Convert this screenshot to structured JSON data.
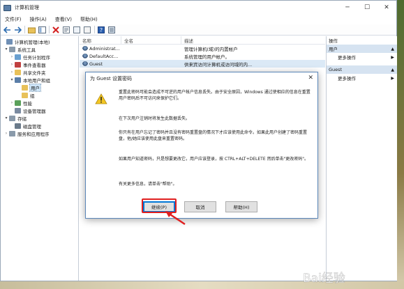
{
  "window": {
    "title": "计算机管理",
    "minimize": "─",
    "maximize": "☐",
    "close": "✕"
  },
  "menu": [
    "文件(F)",
    "操作(A)",
    "查看(V)",
    "帮助(H)"
  ],
  "tree": {
    "root": "计算机管理(本地)",
    "system_tools": "系统工具",
    "task_scheduler": "任务计划程序",
    "event_viewer": "事件查看器",
    "shared_folders": "共享文件夹",
    "local_users_groups": "本地用户和组",
    "users": "用户",
    "groups": "组",
    "performance": "性能",
    "device_manager": "设备管理器",
    "storage": "存储",
    "disk_management": "磁盘管理",
    "services_apps": "服务和应用程序"
  },
  "list": {
    "headers": [
      "名称",
      "全名",
      "描述"
    ],
    "rows": [
      {
        "name": "Administrat...",
        "fullname": "",
        "desc": "管理计算机(域)的内置帐户"
      },
      {
        "name": "DefaultAcc...",
        "fullname": "",
        "desc": "系统管理的用户帐户。"
      },
      {
        "name": "Guest",
        "fullname": "",
        "desc": "供来宾访问计算机或访问域的内..."
      }
    ]
  },
  "actions": {
    "header": "操作",
    "section1": "用户",
    "item1": "更多操作",
    "section2": "Guest",
    "item2": "更多操作"
  },
  "dialog": {
    "title": "为 Guest 设置密码",
    "close": "✕",
    "para1": "重置此密码可能会造成不可逆的用户帐户信息丢失。由于安全原因，Windows 通过使相应的信息在重置用户密码后不可访问来保护它们。",
    "para2": "在下次用户注销时将发生此数据丢失。",
    "para3": "你只有在用户忘记了密码并且没有密码重置盘的情况下才应该使用此命令。如果此用户创建了密码重置盘，他/她应该使用此盘来重置密码。",
    "para4": "如果用户知道密码，只是想要更改它，用户应该登录，按 CTRL+ALT+DELETE 然后单击\"更改密码\"。",
    "para5": "有关更多信息，请单击\"帮助\"。",
    "continue_btn": "继续(P)",
    "cancel_btn": "取消",
    "help_btn": "帮助(H)"
  },
  "watermark": "Bai经验"
}
